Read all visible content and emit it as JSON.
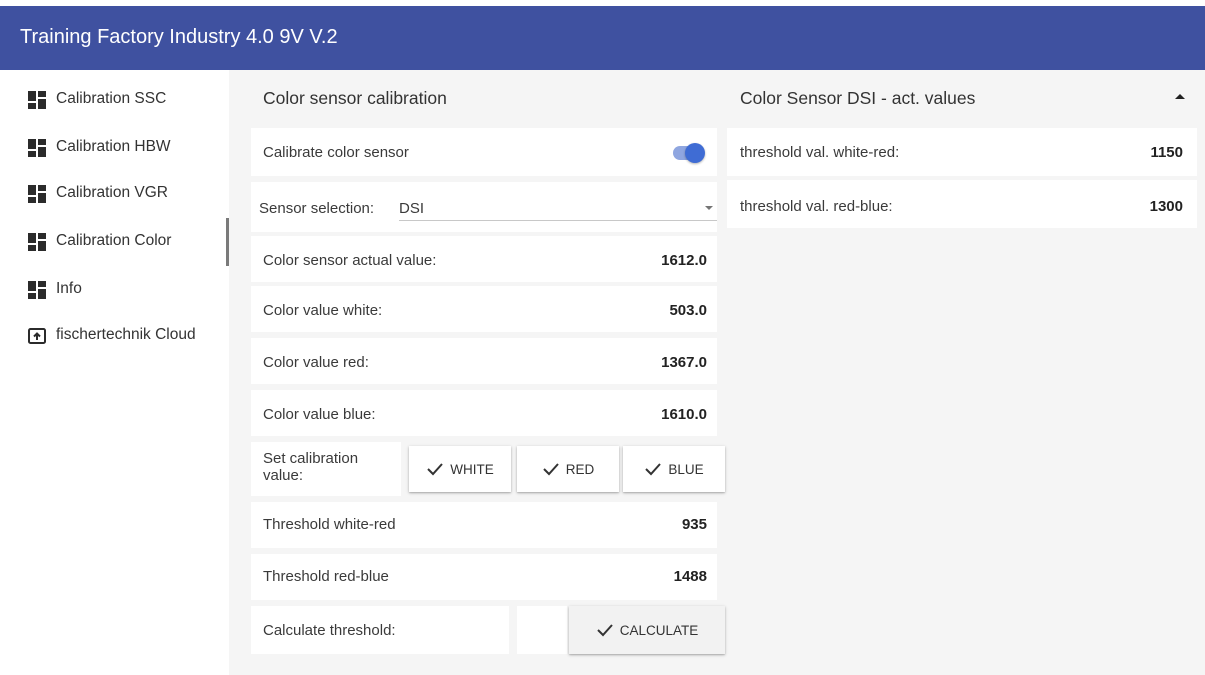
{
  "app": {
    "title": "Training Factory Industry 4.0 9V V.2"
  },
  "sidebar": {
    "items": [
      {
        "label": "Calibration SSC",
        "icon": "dashboard-icon"
      },
      {
        "label": "Calibration HBW",
        "icon": "dashboard-icon"
      },
      {
        "label": "Calibration VGR",
        "icon": "dashboard-icon"
      },
      {
        "label": "Calibration Color",
        "icon": "dashboard-icon",
        "active": true
      },
      {
        "label": "Info",
        "icon": "dashboard-icon"
      },
      {
        "label": "fischertechnik Cloud",
        "icon": "cloud-upload-icon"
      }
    ]
  },
  "calibration": {
    "title": "Color sensor calibration",
    "calibrate_label": "Calibrate color sensor",
    "calibrate_enabled": true,
    "sensor_selection_label": "Sensor selection:",
    "sensor_selection_value": "DSI",
    "actual_value_label": "Color sensor actual value:",
    "actual_value": "1612.0",
    "white_label": "Color value white:",
    "white_value": "503.0",
    "red_label": "Color value red:",
    "red_value": "1367.0",
    "blue_label": "Color value blue:",
    "blue_value": "1610.0",
    "set_calibration_label": "Set calibration value:",
    "btn_white": "WHITE",
    "btn_red": "RED",
    "btn_blue": "BLUE",
    "threshold_white_red_label": "Threshold white-red",
    "threshold_white_red_value": "935",
    "threshold_red_blue_label": "Threshold red-blue",
    "threshold_red_blue_value": "1488",
    "calculate_label": "Calculate threshold:",
    "btn_calculate": "CALCULATE"
  },
  "dsi_panel": {
    "title": "Color Sensor DSI - act. values",
    "rows": [
      {
        "label": "threshold val. white-red:",
        "value": "1150"
      },
      {
        "label": "threshold val. red-blue:",
        "value": "1300"
      }
    ]
  },
  "colors": {
    "header": "#3f51a0",
    "toggle": "#3f6cd4",
    "background": "#f5f5f5"
  }
}
